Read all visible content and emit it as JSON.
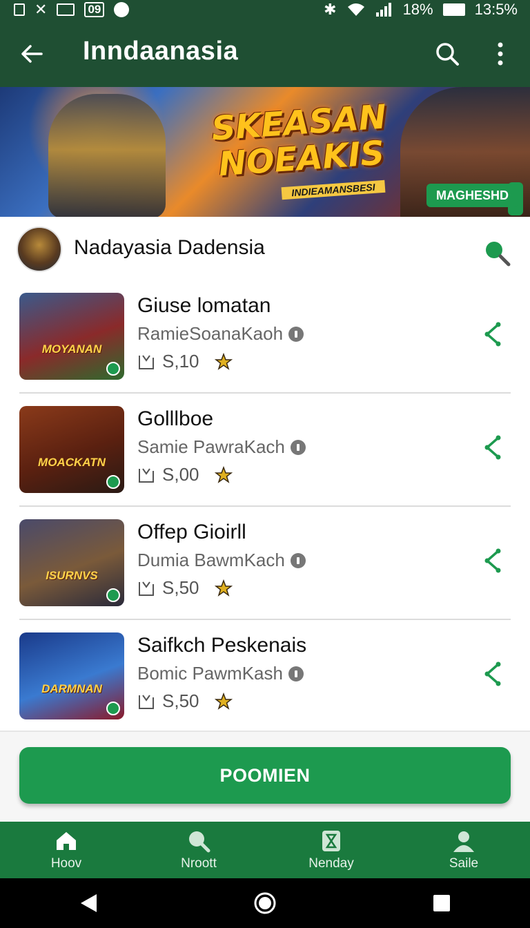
{
  "status_bar": {
    "left_badge": "09",
    "battery": "18%",
    "time": "13:5%"
  },
  "app_bar": {
    "title": "Inndaanasia"
  },
  "banner": {
    "title_line1": "SKEASAN",
    "title_line2": "NOEAKIS",
    "subtitle": "INDIEAMANSBESI",
    "pill_label": "MAGHESHD"
  },
  "channel": {
    "name": "Nadayasia Dadensia"
  },
  "items": [
    {
      "title": "Giuse lomatan",
      "subtitle": "RamieSoanaKaoh",
      "value": "S,10",
      "thumb_text": "MOYANAN",
      "thumb_colors": [
        "#3a5a8c",
        "#8a2a2a",
        "#2e6a2e"
      ]
    },
    {
      "title": "Golllboe",
      "subtitle": "Samie PawraKach",
      "value": "S,00",
      "thumb_text": "MOACKATN",
      "thumb_colors": [
        "#8a3a1a",
        "#5a2010",
        "#2a1a14"
      ]
    },
    {
      "title": "Offep Gioirll",
      "subtitle": "Dumia BawmKach",
      "value": "S,50",
      "thumb_text": "ISURNVS",
      "thumb_colors": [
        "#4a4a6a",
        "#7a5a3a",
        "#2a2a3a"
      ]
    },
    {
      "title": "Saifkch Peskenais",
      "subtitle": "Bomic PawmKash",
      "value": "S,50",
      "thumb_text": "DARMNAN",
      "thumb_colors": [
        "#1a3a8a",
        "#3a7ad0",
        "#8a1a2a"
      ]
    }
  ],
  "primary_action": {
    "label": "POOMIEN"
  },
  "bottom_nav": [
    {
      "label": "Hoov",
      "icon": "home-icon"
    },
    {
      "label": "Nrοott",
      "icon": "search-icon"
    },
    {
      "label": "Nenday",
      "icon": "hourglass-icon"
    },
    {
      "label": "Saile",
      "icon": "profile-icon"
    }
  ],
  "colors": {
    "app_bar": "#1f4f33",
    "accent": "#1d9a4f",
    "bottom_nav": "#1a7a3e"
  }
}
